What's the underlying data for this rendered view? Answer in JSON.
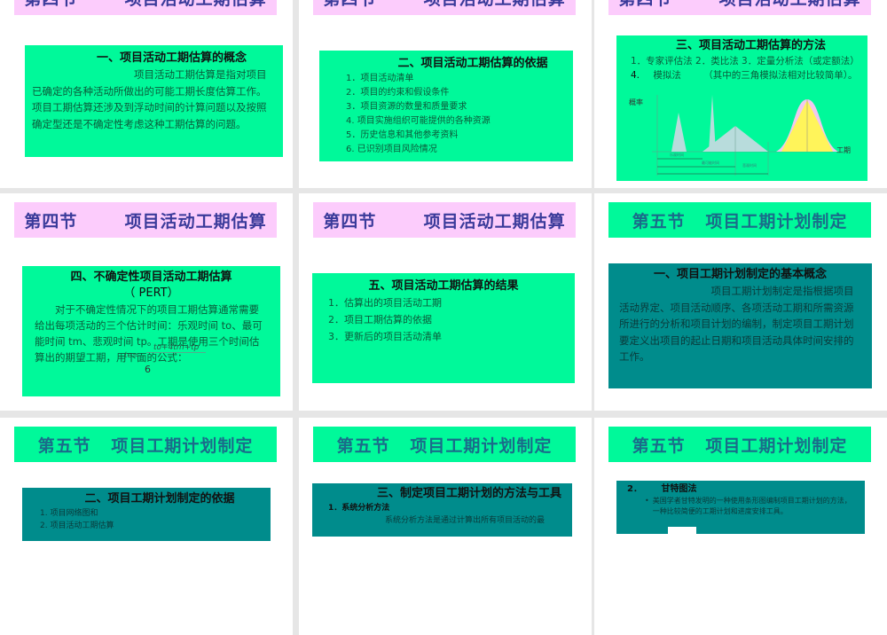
{
  "slides": [
    {
      "title": "第四节       项目活动工期估算",
      "heading": "一、项目活动工期估算的概念",
      "body": "项目活动工期估算是指对项目已确定的各种活动所做出的可能工期长度估算工作。项目工期估算还涉及到浮动时间的计算问题以及按照确定型还是不确定性考虑这种工期估算的问题。"
    },
    {
      "title": "第四节       项目活动工期估算",
      "heading": "二、项目活动工期估算的依据",
      "items": [
        "1．项目活动清单",
        "2．项目的约束和假设条件",
        "3．项目资源的数量和质量要求",
        "4.  项目实施组织可能提供的各种资源",
        "5．历史信息和其他参考资料",
        "6.   已识别项目风险情况"
      ]
    },
    {
      "title": "第四节       项目活动工期估算",
      "heading": "三、项目活动工期估算的方法",
      "line1": "1．专家评估法   2．类比法   3．定量分析法（或定额法）",
      "line2_num": "4.",
      "line2_a": "模拟法",
      "line2_b": "（其中的三角模拟法相对比较简单）。",
      "chart": {
        "ylabel": "概率",
        "xlabel": "工期",
        "optimistic": "乐观时间",
        "most_likely": "最可能时间",
        "pessimistic": "悲观时间"
      }
    },
    {
      "title": "第四节       项目活动工期估算",
      "heading": "四、不确定性项目活动工期估算",
      "heading2": "（ PERT）",
      "body": "对于不确定性情况下的项目工期估算通常需要给出每项活动的三个估计时间：乐观时间 to、最可能时间 tm、悲观时间 tp。工期是使用三个时间估算出的期望工期，用下面的公式：",
      "formula_lhs": "te=",
      "formula_num": "to+4tm+tp",
      "formula_den": "6"
    },
    {
      "title": "第四节       项目活动工期估算",
      "heading": "五、项目活动工期估算的结果",
      "items": [
        "1．估算出的项目活动工期",
        "2．项目工期估算的依据",
        "3．更新后的项目活动清单"
      ]
    },
    {
      "title": "第五节   项目工期计划制定",
      "heading": "一、项目工期计划制定的基本概念",
      "body": "项目工期计划制定是指根据项目活动界定、项目活动顺序、各项活动工期和所需资源所进行的分析和项目计划的编制，制定项目工期计划要定义出项目的起止日期和项目活动具体时间安排的工作。"
    },
    {
      "title": "第五节   项目工期计划制定",
      "heading": "二、项目工期计划制定的依据",
      "items": [
        "1.   项目网络图和",
        "2.   项目活动工期估算"
      ]
    },
    {
      "title": "第五节   项目工期计划制定",
      "heading": "三、制定项目工期计划的方法与工具",
      "sub": "1．系统分析方法",
      "body": "系统分析方法是通过计算出所有项目活动的最"
    },
    {
      "title": "第五节   项目工期计划制定",
      "sub_num": "2．",
      "sub": "甘特图法",
      "bullet": "美国学者甘特发明的一种使用条形图编制项目工期计划的方法，一种比较简便的工期计划和进度安排工具。"
    }
  ],
  "colors": {
    "pink": "#fcccfc",
    "green": "#00f99a",
    "teal": "#008c8c",
    "navy": "#3a3a9a"
  }
}
